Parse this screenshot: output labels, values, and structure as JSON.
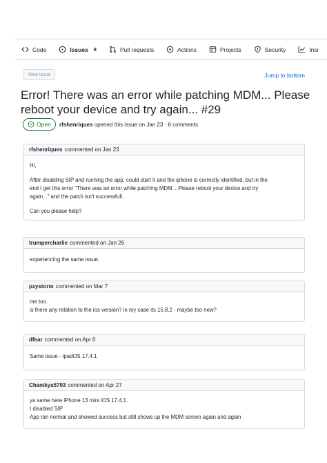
{
  "tabs": [
    {
      "label": "Code",
      "icon": "code-icon"
    },
    {
      "label": "Issues",
      "icon": "issue-opened-icon",
      "count": "8",
      "selected": true
    },
    {
      "label": "Pull requests",
      "icon": "git-pull-request-icon"
    },
    {
      "label": "Actions",
      "icon": "play-icon"
    },
    {
      "label": "Projects",
      "icon": "table-icon"
    },
    {
      "label": "Security",
      "icon": "shield-icon"
    },
    {
      "label": "Insi",
      "icon": "graph-icon"
    }
  ],
  "new_issue_label": "New issue",
  "jump_label": "Jump to bottom",
  "issue": {
    "title": "Error! There was an error while patching MDM... Please reboot your device and try again... #29",
    "state": "Open",
    "author": "rfshenriques",
    "meta": "opened this issue on Jan 23 · 6 comments"
  },
  "comments": [
    {
      "author": "rfshenriques",
      "date": "commented on Jan 23",
      "paragraphs": [
        [
          "Hi,"
        ],
        [
          "After disabling SIP and running the app, could start it and the iphone is correctly identified, but in the",
          "end I get this error \"There was an error while patching MDM... Please reboot your device and try",
          "again...\" and the patch isn't successfull."
        ],
        [
          "Can you please help?"
        ]
      ]
    },
    {
      "author": "trumpercharlie",
      "date": "commented on Jan 26",
      "paragraphs": [
        [
          "experiencing the same issue."
        ]
      ]
    },
    {
      "author": "pzystorm",
      "date": "commented on Mar 7",
      "paragraphs": [
        [
          "me too.",
          "is there any relation to the ios version? in my case its 15.8.2 - maybe too new?"
        ]
      ]
    },
    {
      "author": "dfear",
      "date": "commented on Apr 6",
      "paragraphs": [
        [
          "Same issue - ipadOS 17.4.1"
        ]
      ]
    },
    {
      "author": "Chanikya5793",
      "date": "commented on Apr 27",
      "paragraphs": [
        [
          "ya same here iPhone 13 mini iOS 17.4.1.",
          "I disabled SIP",
          "App ran normal and showed success but still shows up the MDM screen again and again"
        ]
      ]
    }
  ],
  "colors": {
    "link": "#0969da",
    "open_green": "#1a7f37",
    "border": "#d0d7de",
    "header_bg": "#f6f8fa",
    "tab_underline": "#fd8c73"
  }
}
